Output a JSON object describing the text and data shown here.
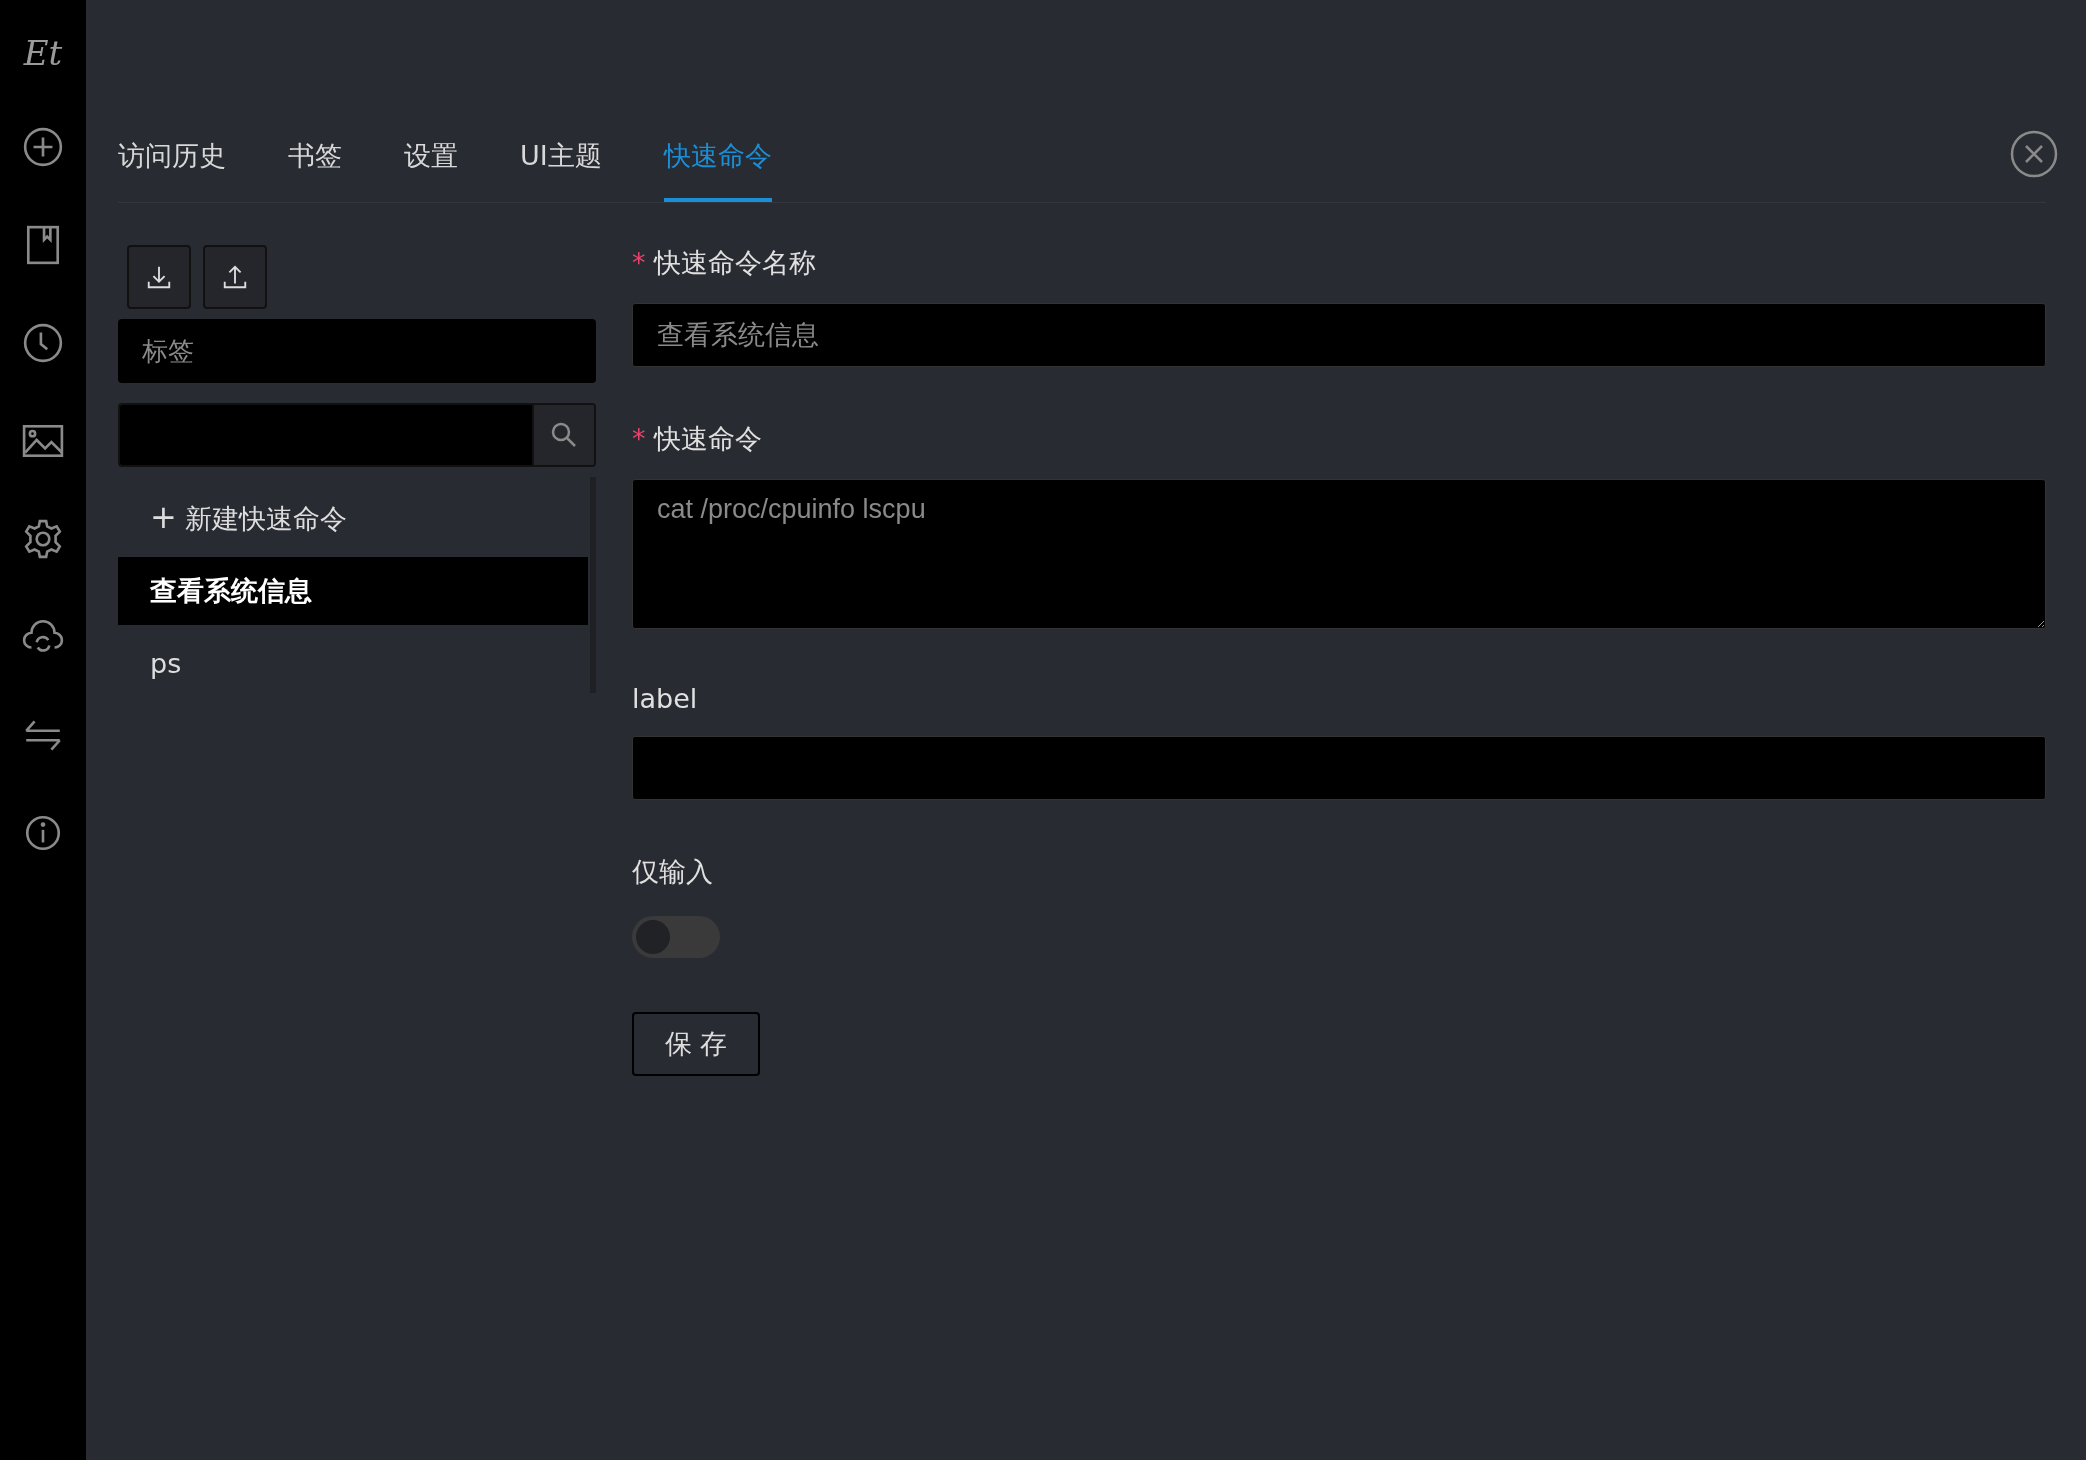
{
  "sidebar": {
    "items": [
      {
        "kind": "logo",
        "label": "Et"
      },
      {
        "kind": "add"
      },
      {
        "kind": "bookmark"
      },
      {
        "kind": "history"
      },
      {
        "kind": "image"
      },
      {
        "kind": "settings"
      },
      {
        "kind": "sync"
      },
      {
        "kind": "transfer"
      },
      {
        "kind": "info"
      }
    ]
  },
  "tabs": [
    {
      "label": "访问历史",
      "selected": false
    },
    {
      "label": "书签",
      "selected": false
    },
    {
      "label": "设置",
      "selected": false
    },
    {
      "label": "UI主题",
      "selected": false
    },
    {
      "label": "快速命令",
      "selected": true
    }
  ],
  "list_panel": {
    "tag_select": {
      "placeholder": "标签"
    },
    "new_item": {
      "icon": "+",
      "label": "新建快速命令"
    },
    "items": [
      {
        "label": "查看系统信息",
        "selected": true
      },
      {
        "label": "ps",
        "selected": false
      }
    ]
  },
  "form": {
    "fields": [
      {
        "kind": "input",
        "label": "快速命令名称",
        "required": true,
        "value": "查看系统信息"
      },
      {
        "kind": "textarea",
        "label": "快速命令",
        "required": true,
        "value": "cat /proc/cpuinfo lscpu"
      },
      {
        "kind": "input",
        "label": "label",
        "required": false
      },
      {
        "kind": "switch",
        "label": "仅输入",
        "required": false,
        "on": false
      }
    ],
    "required_mark": "*",
    "save_button": "保 存"
  }
}
